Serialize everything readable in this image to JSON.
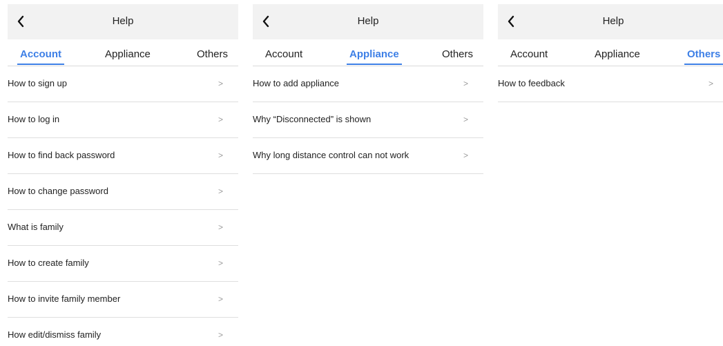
{
  "panels": [
    {
      "title": "Help",
      "tabs": [
        "Account",
        "Appliance",
        "Others"
      ],
      "active_tab": "Account",
      "items": [
        "How to sign up",
        "How to log in",
        "How to find back password",
        "How to change password",
        "What is family",
        "How to create family",
        "How to invite family member",
        "How edit/dismiss family"
      ]
    },
    {
      "title": "Help",
      "tabs": [
        "Account",
        "Appliance",
        "Others"
      ],
      "active_tab": "Appliance",
      "items": [
        "How to add appliance",
        "Why “Disconnected” is shown",
        "Why long distance control can not work"
      ]
    },
    {
      "title": "Help",
      "tabs": [
        "Account",
        "Appliance",
        "Others"
      ],
      "active_tab": "Others",
      "items": [
        "How to feedback"
      ]
    }
  ],
  "chevron": ">",
  "colors": {
    "accent": "#3d7fe6",
    "header_bg": "#f2f2f2",
    "divider": "#dedede"
  },
  "icons": {
    "back": "back-arrow-icon",
    "row": "chevron-right-icon"
  }
}
